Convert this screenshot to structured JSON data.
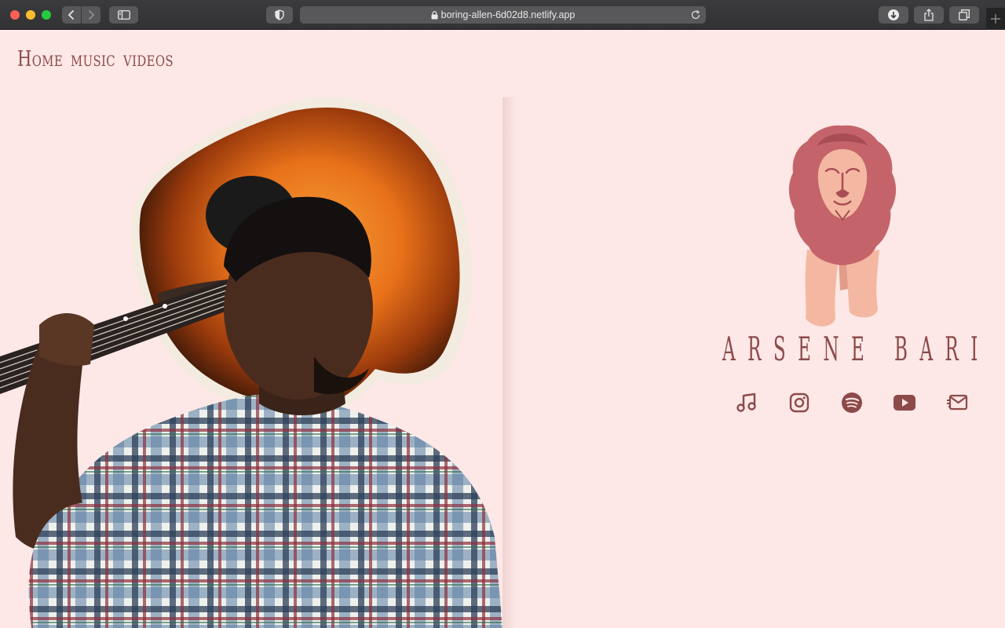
{
  "browser": {
    "url": "boring-allen-6d02d8.netlify.app",
    "icons": [
      "back-icon",
      "forward-icon",
      "sidebar-icon",
      "shield-icon",
      "lock-icon",
      "reload-icon",
      "download-icon",
      "share-icon",
      "tabs-icon",
      "plus-icon"
    ]
  },
  "nav": {
    "items": [
      {
        "label": "Home"
      },
      {
        "label": "music"
      },
      {
        "label": "videos"
      }
    ]
  },
  "artist": {
    "name": "ARSENE BARI"
  },
  "socials": [
    {
      "icon": "music-note-icon"
    },
    {
      "icon": "instagram-icon"
    },
    {
      "icon": "spotify-icon"
    },
    {
      "icon": "youtube-icon"
    },
    {
      "icon": "mail-icon"
    }
  ],
  "colors": {
    "background": "#fde8e7",
    "accent": "#8c4a4a",
    "lion_mane": "#c4646a",
    "lion_body": "#f4b8a2"
  }
}
